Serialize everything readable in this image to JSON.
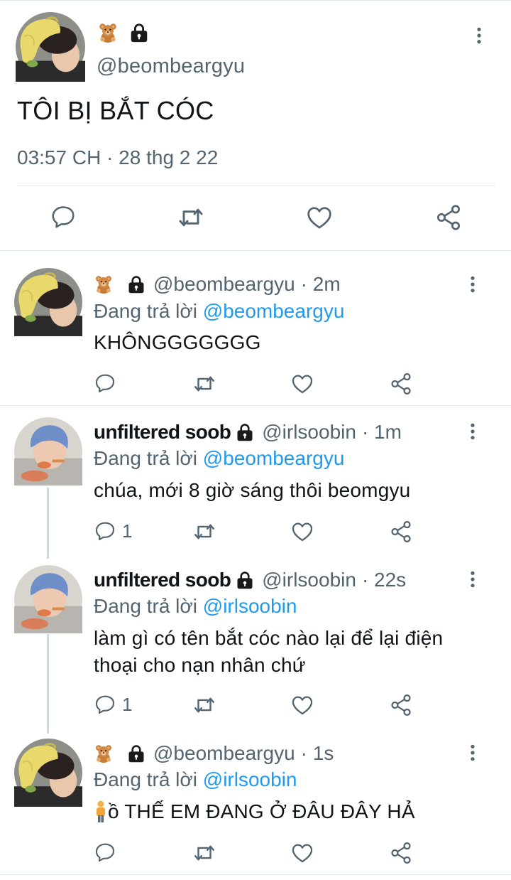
{
  "main_tweet": {
    "handle": "@beombeargyu",
    "emojis": [
      "bear-emoji",
      "lock-emoji"
    ],
    "text": "TÔI BỊ BẮT CÓC",
    "meta": "03:57 CH · 28 thg 2 22",
    "actions": [
      "reply-icon",
      "retweet-icon",
      "like-icon",
      "share-icon"
    ]
  },
  "replies": [
    {
      "name": "",
      "handle": "@beombeargyu",
      "time": "· 2m",
      "replying_prefix": "Đang trả lời",
      "replying_to": "@beombeargyu",
      "body": "KHÔNGGGGGGG",
      "reply_count": ""
    },
    {
      "name": "unfiltered soob",
      "handle": "@irlsoobin",
      "time": "· 1m",
      "replying_prefix": "Đang trả lời",
      "replying_to": "@beombeargyu",
      "body": "chúa, mới 8 giờ sáng thôi beomgyu",
      "reply_count": "1"
    },
    {
      "name": "unfiltered soob",
      "handle": "@irlsoobin",
      "time": "· 22s",
      "replying_prefix": "Đang trả lời",
      "replying_to": "@irlsoobin",
      "body_lines": [
        "làm gì có tên bắt cóc nào lại để lại điện",
        "thoại cho nạn nhân chứ"
      ],
      "reply_count": "1"
    },
    {
      "name": "",
      "handle": "@beombeargyu",
      "time": "· 1s",
      "replying_prefix": "Đang trả lời",
      "replying_to": "@irlsoobin",
      "body": "ồ THẾ EM ĐANG Ở ĐÂU ĐÂY HẢ",
      "reply_count": ""
    }
  ],
  "colors": {
    "text": "#0f1419",
    "secondary": "#536471",
    "link": "#1d9bf0",
    "divider": "#e1e8ed"
  }
}
